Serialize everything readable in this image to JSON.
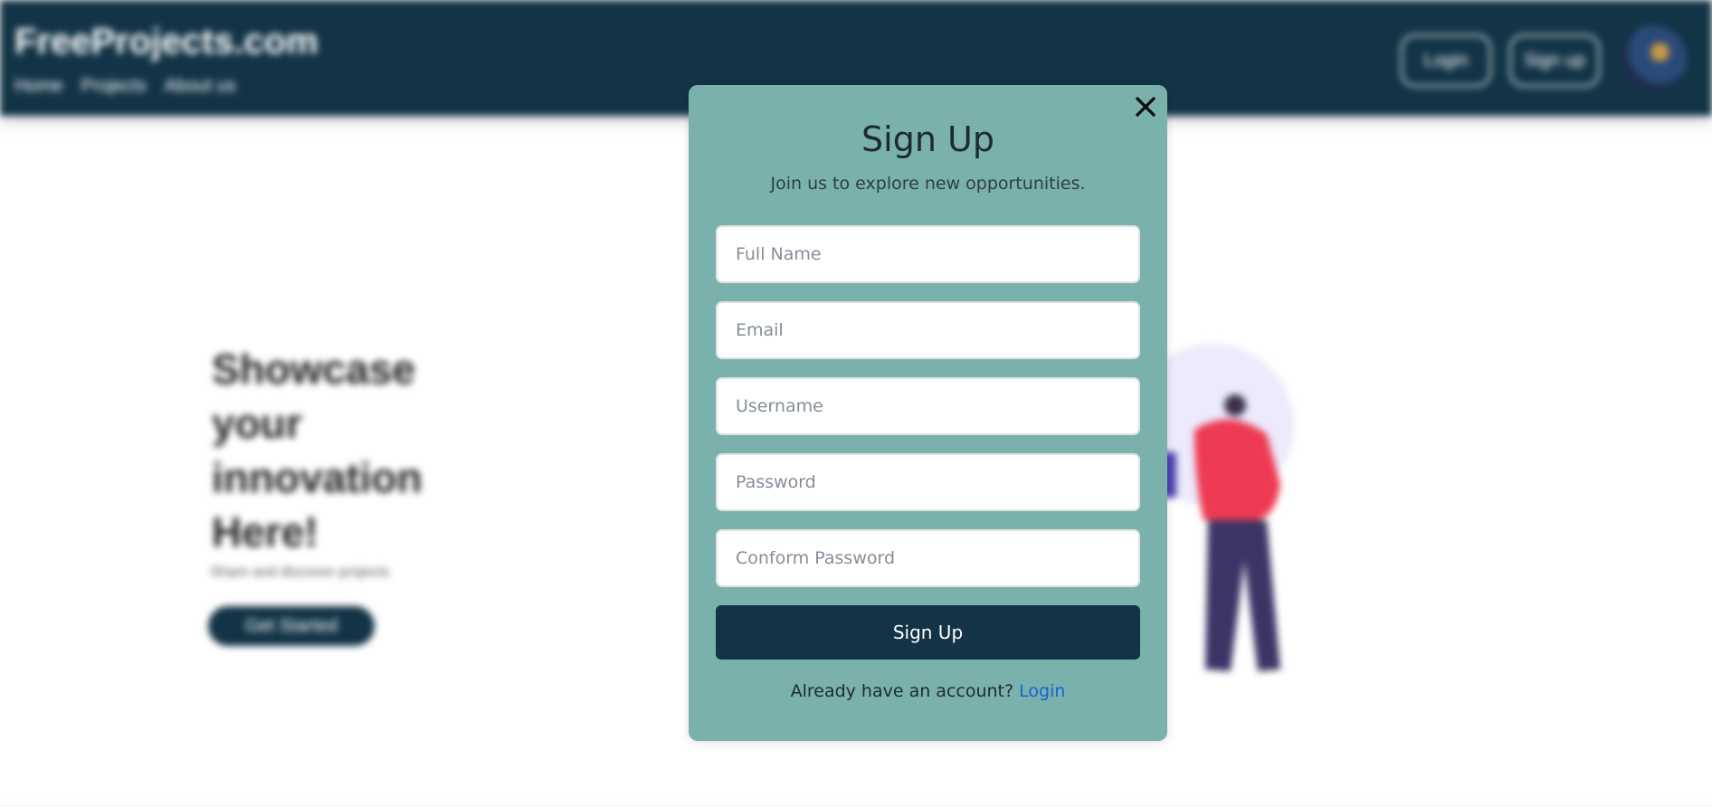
{
  "background_page": {
    "brand": "FreeProjects.com",
    "nav_links": [
      "Home",
      "Projects",
      "About us"
    ],
    "login_button": "Login",
    "signup_button": "Sign up",
    "hero_title": "Showcase your innovation Here!",
    "hero_subtitle": "Share and discover projects",
    "hero_button": "Get Started"
  },
  "modal": {
    "title": "Sign Up",
    "subtitle": "Join us to explore new opportunities.",
    "fields": {
      "full_name": {
        "placeholder": "Full Name",
        "value": ""
      },
      "email": {
        "placeholder": "Email",
        "value": ""
      },
      "username": {
        "placeholder": "Username",
        "value": ""
      },
      "password": {
        "placeholder": "Password",
        "value": ""
      },
      "confirm_password": {
        "placeholder": "Conform Password",
        "value": ""
      }
    },
    "submit_label": "Sign Up",
    "footer_text": "Already have an account?",
    "login_link": "Login",
    "close_icon": "close-icon"
  },
  "colors": {
    "navbar": "#123446",
    "modal_bg": "#7ab1ac",
    "submit_bg": "#123446",
    "link": "#1a63d6"
  }
}
